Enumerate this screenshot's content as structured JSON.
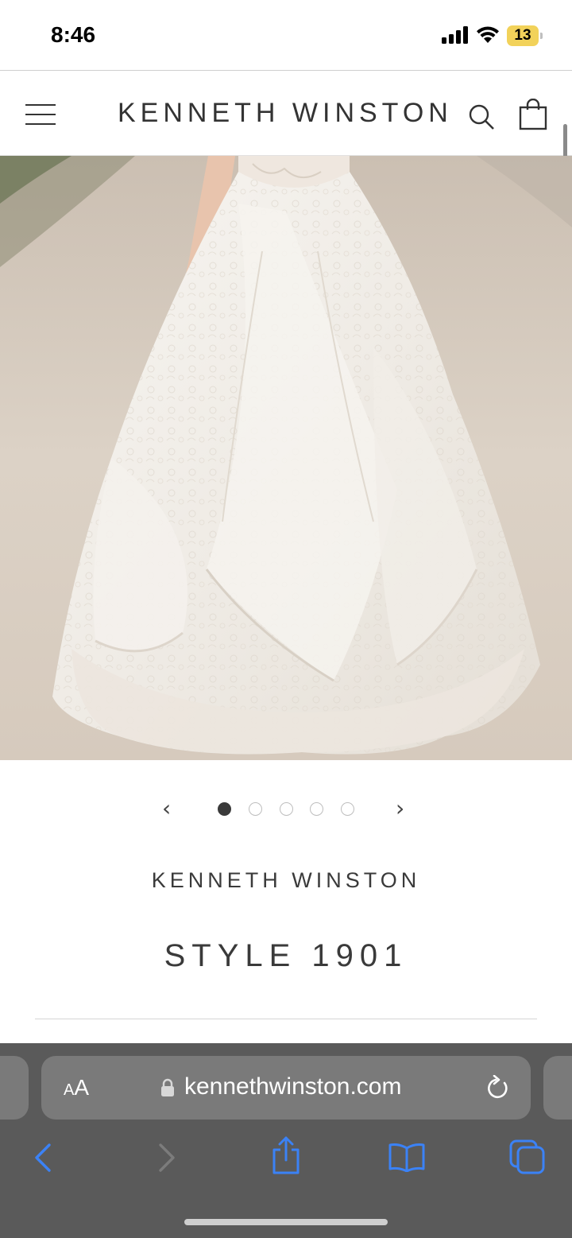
{
  "status_bar": {
    "time": "8:46",
    "battery_level": "13",
    "battery_color": "#f2d25a"
  },
  "header": {
    "brand": "KENNETH WINSTON",
    "menu_icon": "hamburger-menu-icon",
    "search_icon": "search-icon",
    "bag_icon": "shopping-bag-icon"
  },
  "hero": {
    "image_subject": "lace ball gown wedding dress skirt"
  },
  "carousel": {
    "prev_label": "‹",
    "next_label": "›",
    "slide_count": 5,
    "active_index": 0
  },
  "product": {
    "designer": "KENNETH WINSTON",
    "style": "STYLE 1901"
  },
  "browser": {
    "aa_small": "A",
    "aa_large": "A",
    "url": "kennethwinston.com",
    "accent_color": "#3b82f6",
    "toolbar_color": "#5a5a5a",
    "icons": [
      "back-icon",
      "forward-icon",
      "share-icon",
      "bookmarks-icon",
      "tabs-icon"
    ]
  }
}
